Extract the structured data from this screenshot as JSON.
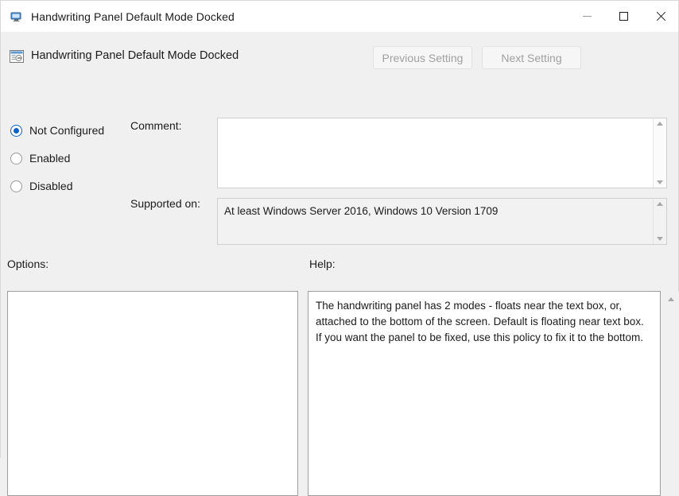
{
  "window": {
    "title": "Handwriting Panel Default Mode Docked",
    "title_icon": "computer-monitor-icon",
    "controls": {
      "minimize": "minimize-icon",
      "maximize": "maximize-icon",
      "close": "close-icon"
    }
  },
  "header": {
    "icon": "policy-setting-icon",
    "title": "Handwriting Panel Default Mode Docked",
    "previous_button": "Previous Setting",
    "next_button": "Next Setting"
  },
  "state_options": [
    {
      "label": "Not Configured",
      "selected": true
    },
    {
      "label": "Enabled",
      "selected": false
    },
    {
      "label": "Disabled",
      "selected": false
    }
  ],
  "fields": {
    "comment_label": "Comment:",
    "comment_value": "",
    "supported_label": "Supported on:",
    "supported_value": "At least Windows Server 2016, Windows 10 Version 1709"
  },
  "panels": {
    "options_label": "Options:",
    "options_value": "",
    "help_label": "Help:",
    "help_value": "The handwriting panel has 2 modes - floats near the text box, or, attached to the bottom of the screen. Default is floating near text box. If you want the panel to be fixed, use this policy to fix it to the bottom."
  },
  "colors": {
    "accent": "#0a63c9",
    "body_background": "#f0f0f0",
    "titlebar_background": "#ffffff",
    "disabled_text": "#a0a0a0",
    "panel_border": "#9e9e9e"
  }
}
